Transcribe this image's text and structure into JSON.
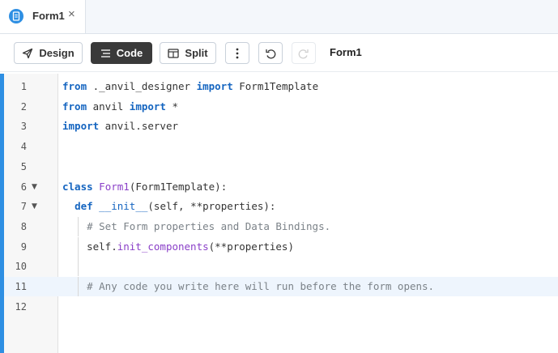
{
  "tab": {
    "label": "Form1",
    "close": "×"
  },
  "toolbar": {
    "design_label": "Design",
    "code_label": "Code",
    "split_label": "Split",
    "form_title": "Form1"
  },
  "editor": {
    "active_line": 11,
    "lines": [
      {
        "number": "1",
        "tokens": [
          {
            "t": "from",
            "c": "kw"
          },
          {
            "t": " ._anvil_designer "
          },
          {
            "t": "import",
            "c": "kw"
          },
          {
            "t": " Form1Template"
          }
        ]
      },
      {
        "number": "2",
        "tokens": [
          {
            "t": "from",
            "c": "kw"
          },
          {
            "t": " anvil "
          },
          {
            "t": "import",
            "c": "kw"
          },
          {
            "t": " *"
          }
        ]
      },
      {
        "number": "3",
        "tokens": [
          {
            "t": "import",
            "c": "kw"
          },
          {
            "t": " anvil.server"
          }
        ]
      },
      {
        "number": "4",
        "tokens": []
      },
      {
        "number": "5",
        "tokens": []
      },
      {
        "number": "6",
        "fold": true,
        "tokens": [
          {
            "t": "class",
            "c": "kw"
          },
          {
            "t": " "
          },
          {
            "t": "Form1",
            "c": "cls"
          },
          {
            "t": "(Form1Template):"
          }
        ]
      },
      {
        "number": "7",
        "fold": true,
        "tokens": [
          {
            "t": "  "
          },
          {
            "t": "def",
            "c": "kw"
          },
          {
            "t": " "
          },
          {
            "t": "__init__",
            "c": "fn"
          },
          {
            "t": "(self, **properties):"
          }
        ]
      },
      {
        "number": "8",
        "tokens": [
          {
            "t": "    "
          },
          {
            "t": "# Set Form properties and Data Bindings.",
            "c": "cm"
          }
        ]
      },
      {
        "number": "9",
        "tokens": [
          {
            "t": "    self."
          },
          {
            "t": "init_components",
            "c": "call"
          },
          {
            "t": "(**properties)"
          }
        ]
      },
      {
        "number": "10",
        "tokens": []
      },
      {
        "number": "11",
        "tokens": [
          {
            "t": "    "
          },
          {
            "t": "# Any code you write here will run before the form opens.",
            "c": "cm"
          }
        ]
      },
      {
        "number": "12",
        "tokens": []
      }
    ]
  }
}
